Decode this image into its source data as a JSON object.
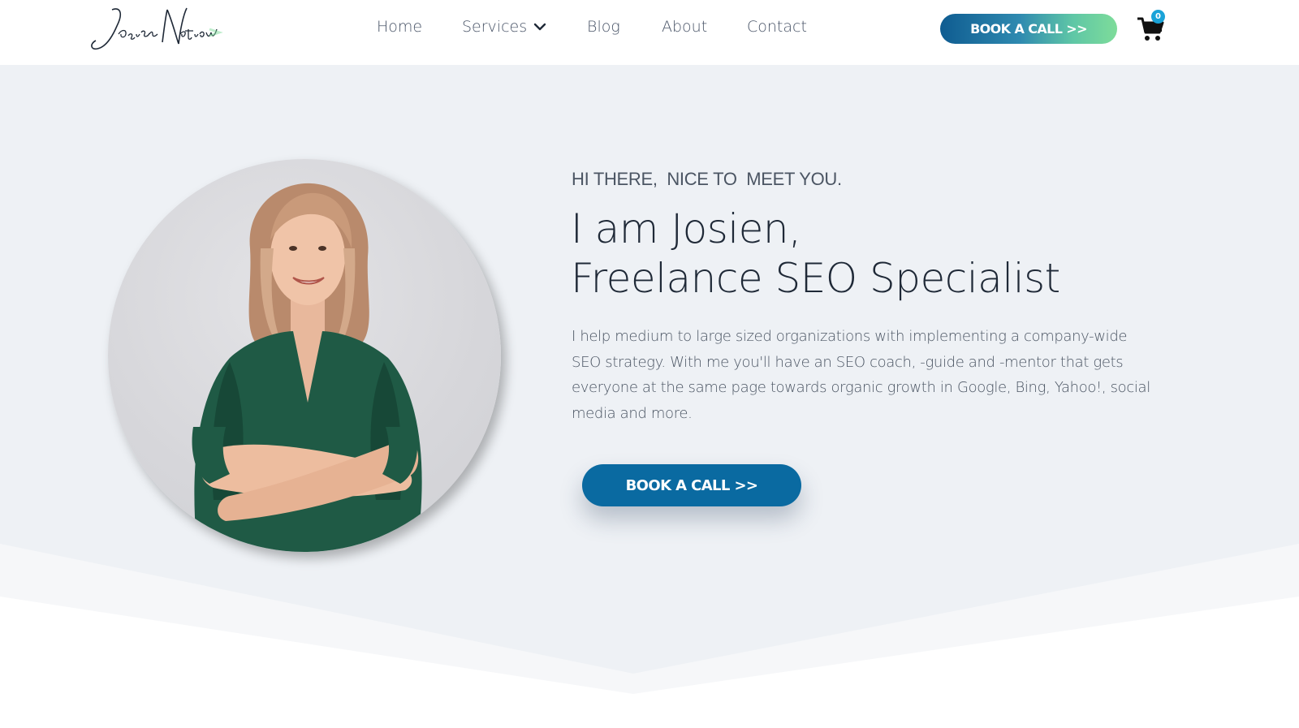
{
  "header": {
    "logo_text": "Josien Nation",
    "nav": [
      {
        "label": "Home"
      },
      {
        "label": "Services"
      },
      {
        "label": "Blog"
      },
      {
        "label": "About"
      },
      {
        "label": "Contact"
      }
    ],
    "cta_label": "BOOK A CALL >>",
    "cart_count": "0"
  },
  "hero": {
    "eyebrow": "HI THERE,  NICE TO  MEET YOU.",
    "headline_line1": "I am Josien,",
    "headline_line2": "Freelance SEO Specialist",
    "intro": "I help medium to large sized organizations with implementing a company-wide SEO strategy. With me you'll have an SEO coach, -guide and -mentor that gets everyone at the same page towards organic growth in Google, Bing, Yahoo!, social media and more.",
    "cta_label": "BOOK A CALL >>"
  },
  "colors": {
    "hero_background": "#eef1f5",
    "primary_button": "#0a6aa1",
    "gradient_start": "#0f5c91",
    "gradient_end": "#7edc9a",
    "cart_badge": "#1aa3d8"
  },
  "icons": [
    "chevron-down-icon",
    "shopping-cart-icon"
  ]
}
